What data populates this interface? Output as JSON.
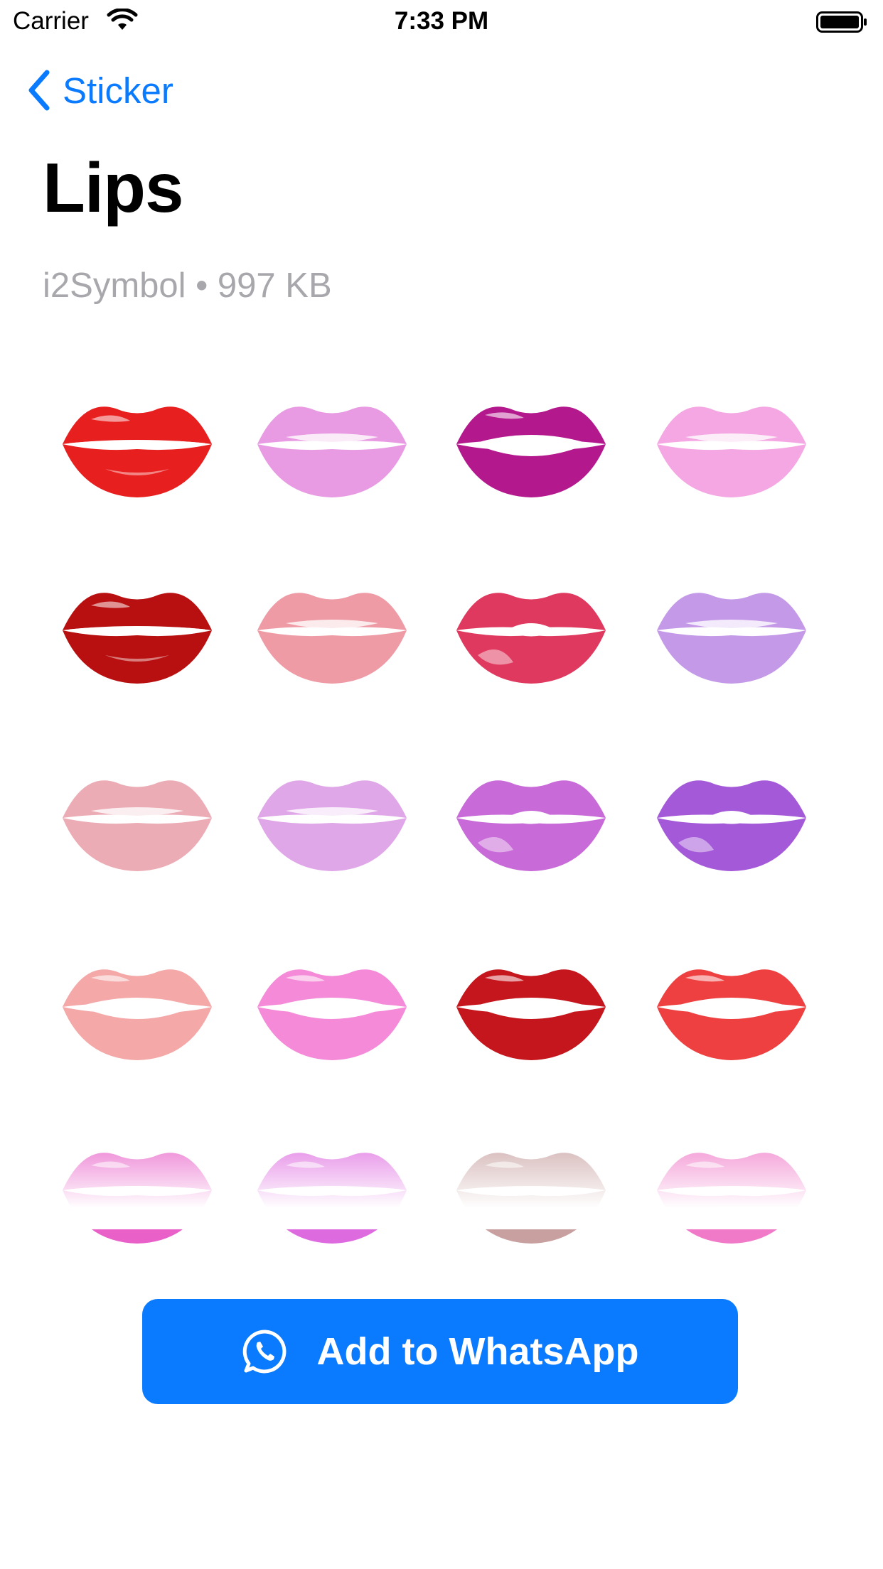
{
  "status_bar": {
    "carrier": "Carrier",
    "time": "7:33 PM"
  },
  "nav": {
    "back_label": "Sticker"
  },
  "pack": {
    "title": "Lips",
    "subtitle": "i2Symbol • 997 KB"
  },
  "stickers": [
    {
      "color": "#e81f1f",
      "style": "glossy"
    },
    {
      "color": "#e07ad8",
      "style": "print"
    },
    {
      "color": "#b3188d",
      "style": "open"
    },
    {
      "color": "#f08ad8",
      "style": "print"
    },
    {
      "color": "#b81010",
      "style": "glossy"
    },
    {
      "color": "#e87a88",
      "style": "print"
    },
    {
      "color": "#e0395f",
      "style": "kiss"
    },
    {
      "color": "#b078e0",
      "style": "print"
    },
    {
      "color": "#e6909c",
      "style": "print"
    },
    {
      "color": "#d58ae0",
      "style": "print"
    },
    {
      "color": "#c86ad8",
      "style": "kiss"
    },
    {
      "color": "#a45ad8",
      "style": "kiss"
    },
    {
      "color": "#f4a8a8",
      "style": "open"
    },
    {
      "color": "#f48ad8",
      "style": "open"
    },
    {
      "color": "#c4161c",
      "style": "open"
    },
    {
      "color": "#ee4040",
      "style": "open"
    },
    {
      "color": "#e860c8",
      "style": "glossy"
    },
    {
      "color": "#de6ae0",
      "style": "glossy"
    },
    {
      "color": "#c8a0a0",
      "style": "glossy"
    },
    {
      "color": "#f07ac8",
      "style": "glossy"
    }
  ],
  "button": {
    "label": "Add to WhatsApp"
  },
  "colors": {
    "accent": "#0a7aff",
    "subtitle": "#a7a7ac"
  }
}
